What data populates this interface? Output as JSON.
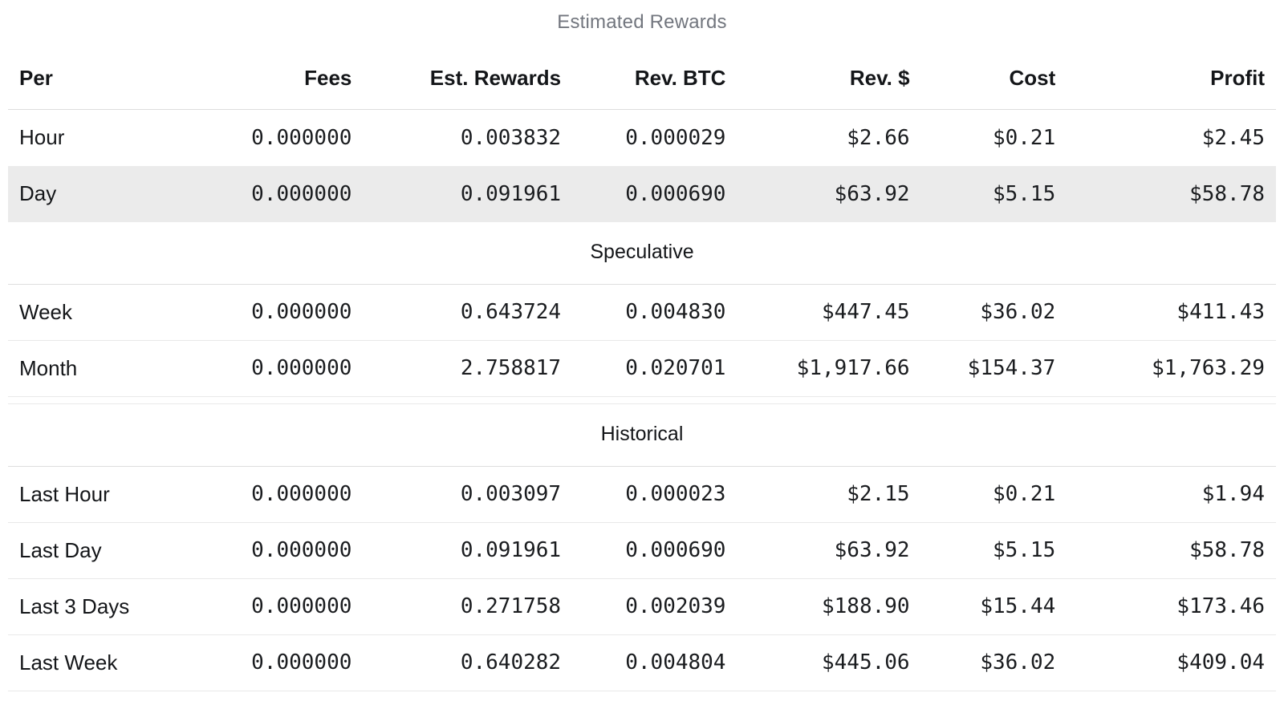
{
  "title": "Estimated Rewards",
  "table": {
    "columns": [
      "Per",
      "Fees",
      "Est. Rewards",
      "Rev. BTC",
      "Rev. $",
      "Cost",
      "Profit"
    ],
    "sections": [
      {
        "header": null,
        "row_dividers": false,
        "rows": [
          {
            "label": "Hour",
            "values": [
              "0.000000",
              "0.003832",
              "0.000029",
              "$2.66",
              "$0.21",
              "$2.45"
            ],
            "highlight": false
          },
          {
            "label": "Day",
            "values": [
              "0.000000",
              "0.091961",
              "0.000690",
              "$63.92",
              "$5.15",
              "$58.78"
            ],
            "highlight": true
          }
        ]
      },
      {
        "header": "Speculative",
        "row_dividers": true,
        "rows": [
          {
            "label": "Week",
            "values": [
              "0.000000",
              "0.643724",
              "0.004830",
              "$447.45",
              "$36.02",
              "$411.43"
            ],
            "highlight": false
          },
          {
            "label": "Month",
            "values": [
              "0.000000",
              "2.758817",
              "0.020701",
              "$1,917.66",
              "$154.37",
              "$1,763.29"
            ],
            "highlight": false
          }
        ]
      },
      {
        "header": "Historical",
        "gap_above": true,
        "row_dividers": true,
        "rows": [
          {
            "label": "Last Hour",
            "values": [
              "0.000000",
              "0.003097",
              "0.000023",
              "$2.15",
              "$0.21",
              "$1.94"
            ],
            "highlight": false
          },
          {
            "label": "Last Day",
            "values": [
              "0.000000",
              "0.091961",
              "0.000690",
              "$63.92",
              "$5.15",
              "$58.78"
            ],
            "highlight": false
          },
          {
            "label": "Last 3 Days",
            "values": [
              "0.000000",
              "0.271758",
              "0.002039",
              "$188.90",
              "$15.44",
              "$173.46"
            ],
            "highlight": false
          },
          {
            "label": "Last Week",
            "values": [
              "0.000000",
              "0.640282",
              "0.004804",
              "$445.06",
              "$36.02",
              "$409.04"
            ],
            "highlight": false
          }
        ]
      }
    ]
  },
  "colors": {
    "highlight_row_bg": "#ebebeb",
    "title_text": "#72767e",
    "row_border": "#e9e9e9",
    "header_border": "#dedede",
    "text": "#1b1d21"
  }
}
